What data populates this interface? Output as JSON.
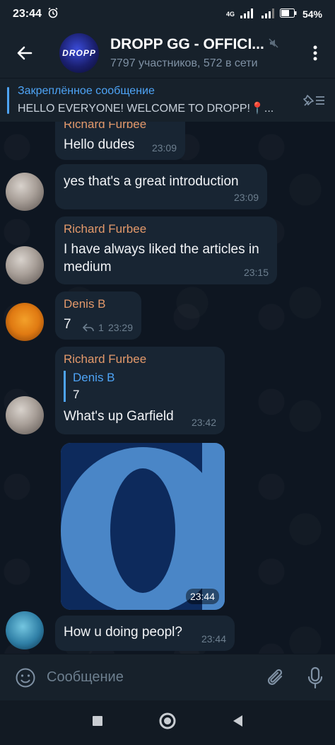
{
  "status_bar": {
    "time": "23:44",
    "network": "4G",
    "battery": "54%"
  },
  "header": {
    "avatar_text": "DROPP",
    "title": "DROPP GG - OFFICI...",
    "subtitle": "7797 участников, 572 в сети"
  },
  "pinned": {
    "title": "Закреплённое сообщение",
    "text": "HELLO EVERYONE!  WELCOME TO DROPP!📍..."
  },
  "messages": [
    {
      "sender": "Richard Furbee",
      "text": "Hello dudes",
      "time": "23:09"
    },
    {
      "sender": "",
      "text": "yes that's a great introduction",
      "time": "23:09"
    },
    {
      "sender": "Richard Furbee",
      "text": "I have always liked the articles in medium",
      "time": "23:15"
    },
    {
      "sender": "Denis B",
      "text": "7",
      "replies": "1",
      "time": "23:29"
    },
    {
      "sender": "Richard Furbee",
      "reply_to": {
        "name": "Denis B",
        "text": "7"
      },
      "text": "What's up Garfield",
      "time": "23:42"
    },
    {
      "sender": "",
      "type": "image",
      "time": "23:44"
    },
    {
      "sender": "",
      "text": "How u doing peopl?",
      "time": "23:44"
    }
  ],
  "composer": {
    "placeholder": "Сообщение"
  },
  "colors": {
    "background": "#0e1621",
    "bar": "#17212b",
    "bubble": "#182533",
    "accent": "#4ea4f6",
    "sender_name": "#e3996b"
  }
}
